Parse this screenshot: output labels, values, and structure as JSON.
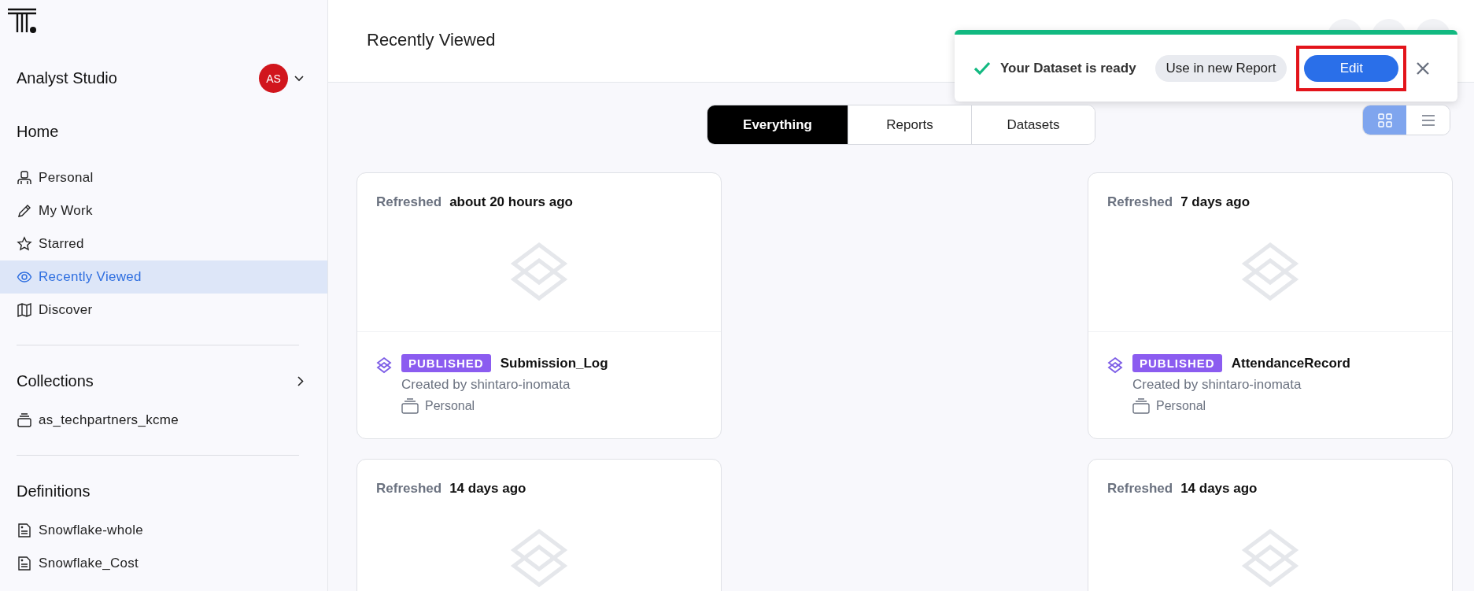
{
  "sidebar": {
    "workspace": "Analyst Studio",
    "avatar": "AS",
    "sections": [
      {
        "title": "Home",
        "has_chevron": false,
        "items": [
          {
            "label": "Personal",
            "kind": "person",
            "selected": false
          },
          {
            "label": "My Work",
            "kind": "pencil",
            "selected": false
          },
          {
            "label": "Starred",
            "kind": "star",
            "selected": false
          },
          {
            "label": "Recently Viewed",
            "kind": "eye",
            "selected": true
          },
          {
            "label": "Discover",
            "kind": "map",
            "selected": false
          }
        ]
      },
      {
        "title": "Collections",
        "has_chevron": true,
        "items": [
          {
            "label": "as_techpartners_kcme",
            "kind": "stack",
            "selected": false
          }
        ]
      },
      {
        "title": "Definitions",
        "has_chevron": false,
        "items": [
          {
            "label": "Snowflake-whole",
            "kind": "doc",
            "selected": false
          },
          {
            "label": "Snowflake_Cost",
            "kind": "doc",
            "selected": false
          }
        ]
      }
    ]
  },
  "header": {
    "title": "Recently Viewed"
  },
  "toast": {
    "message": "Your Dataset is ready",
    "secondary_button": "Use in new Report",
    "primary_button": "Edit"
  },
  "tabs": [
    {
      "label": "Everything",
      "selected": true
    },
    {
      "label": "Reports",
      "selected": false
    },
    {
      "label": "Datasets",
      "selected": false
    }
  ],
  "view_toggle": [
    {
      "kind": "grid",
      "selected": true
    },
    {
      "kind": "list",
      "selected": false
    }
  ],
  "cards": [
    {
      "refreshed_label": "Refreshed",
      "refreshed": "about 20 hours ago",
      "status": "PUBLISHED",
      "name": "Submission_Log",
      "creator": "Created by shintaro-inomata",
      "collection": "Personal"
    },
    {
      "refreshed_label": "Refreshed",
      "refreshed": "7 days ago",
      "status": "PUBLISHED",
      "name": "AttendanceRecord",
      "creator": "Created by shintaro-inomata",
      "collection": "Personal"
    },
    {
      "refreshed_label": "Refreshed",
      "refreshed": "14 days ago"
    },
    {
      "refreshed_label": "Refreshed",
      "refreshed": "14 days ago"
    }
  ]
}
